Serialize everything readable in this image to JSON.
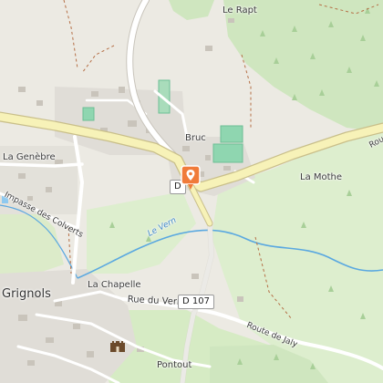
{
  "map": {
    "labels": {
      "le_rapt": "Le Rapt",
      "bruc": "Bruc",
      "la_genebre": "La Genèbre",
      "la_mothe": "La Mothe",
      "impasse_des_colverts": "Impasse des Colverts",
      "le_vern": "Le Vern",
      "grignols": "Grignols",
      "la_chapelle": "La Chapelle",
      "rue_du_vern": "Rue du Vern",
      "route_de_jaly": "Route de Jaly",
      "pontout": "Pontout",
      "rou": "Rou"
    },
    "road_shields": {
      "d107_north": "D",
      "d107_south": "D 107"
    },
    "markers": {
      "selected_location": "location-pin-icon",
      "castle": "castle-icon"
    },
    "colors": {
      "land": "#eceae3",
      "forest": "#cfe6bf",
      "meadow": "#ddeece",
      "main_road": "#f7f2b8",
      "road_casing": "#c9bf8a",
      "secondary_road": "#ffffff",
      "water": "#5aa8e0",
      "boundary": "#b56f46",
      "sport_field": "#8fd6b0",
      "pin": "#f07b3a"
    }
  }
}
